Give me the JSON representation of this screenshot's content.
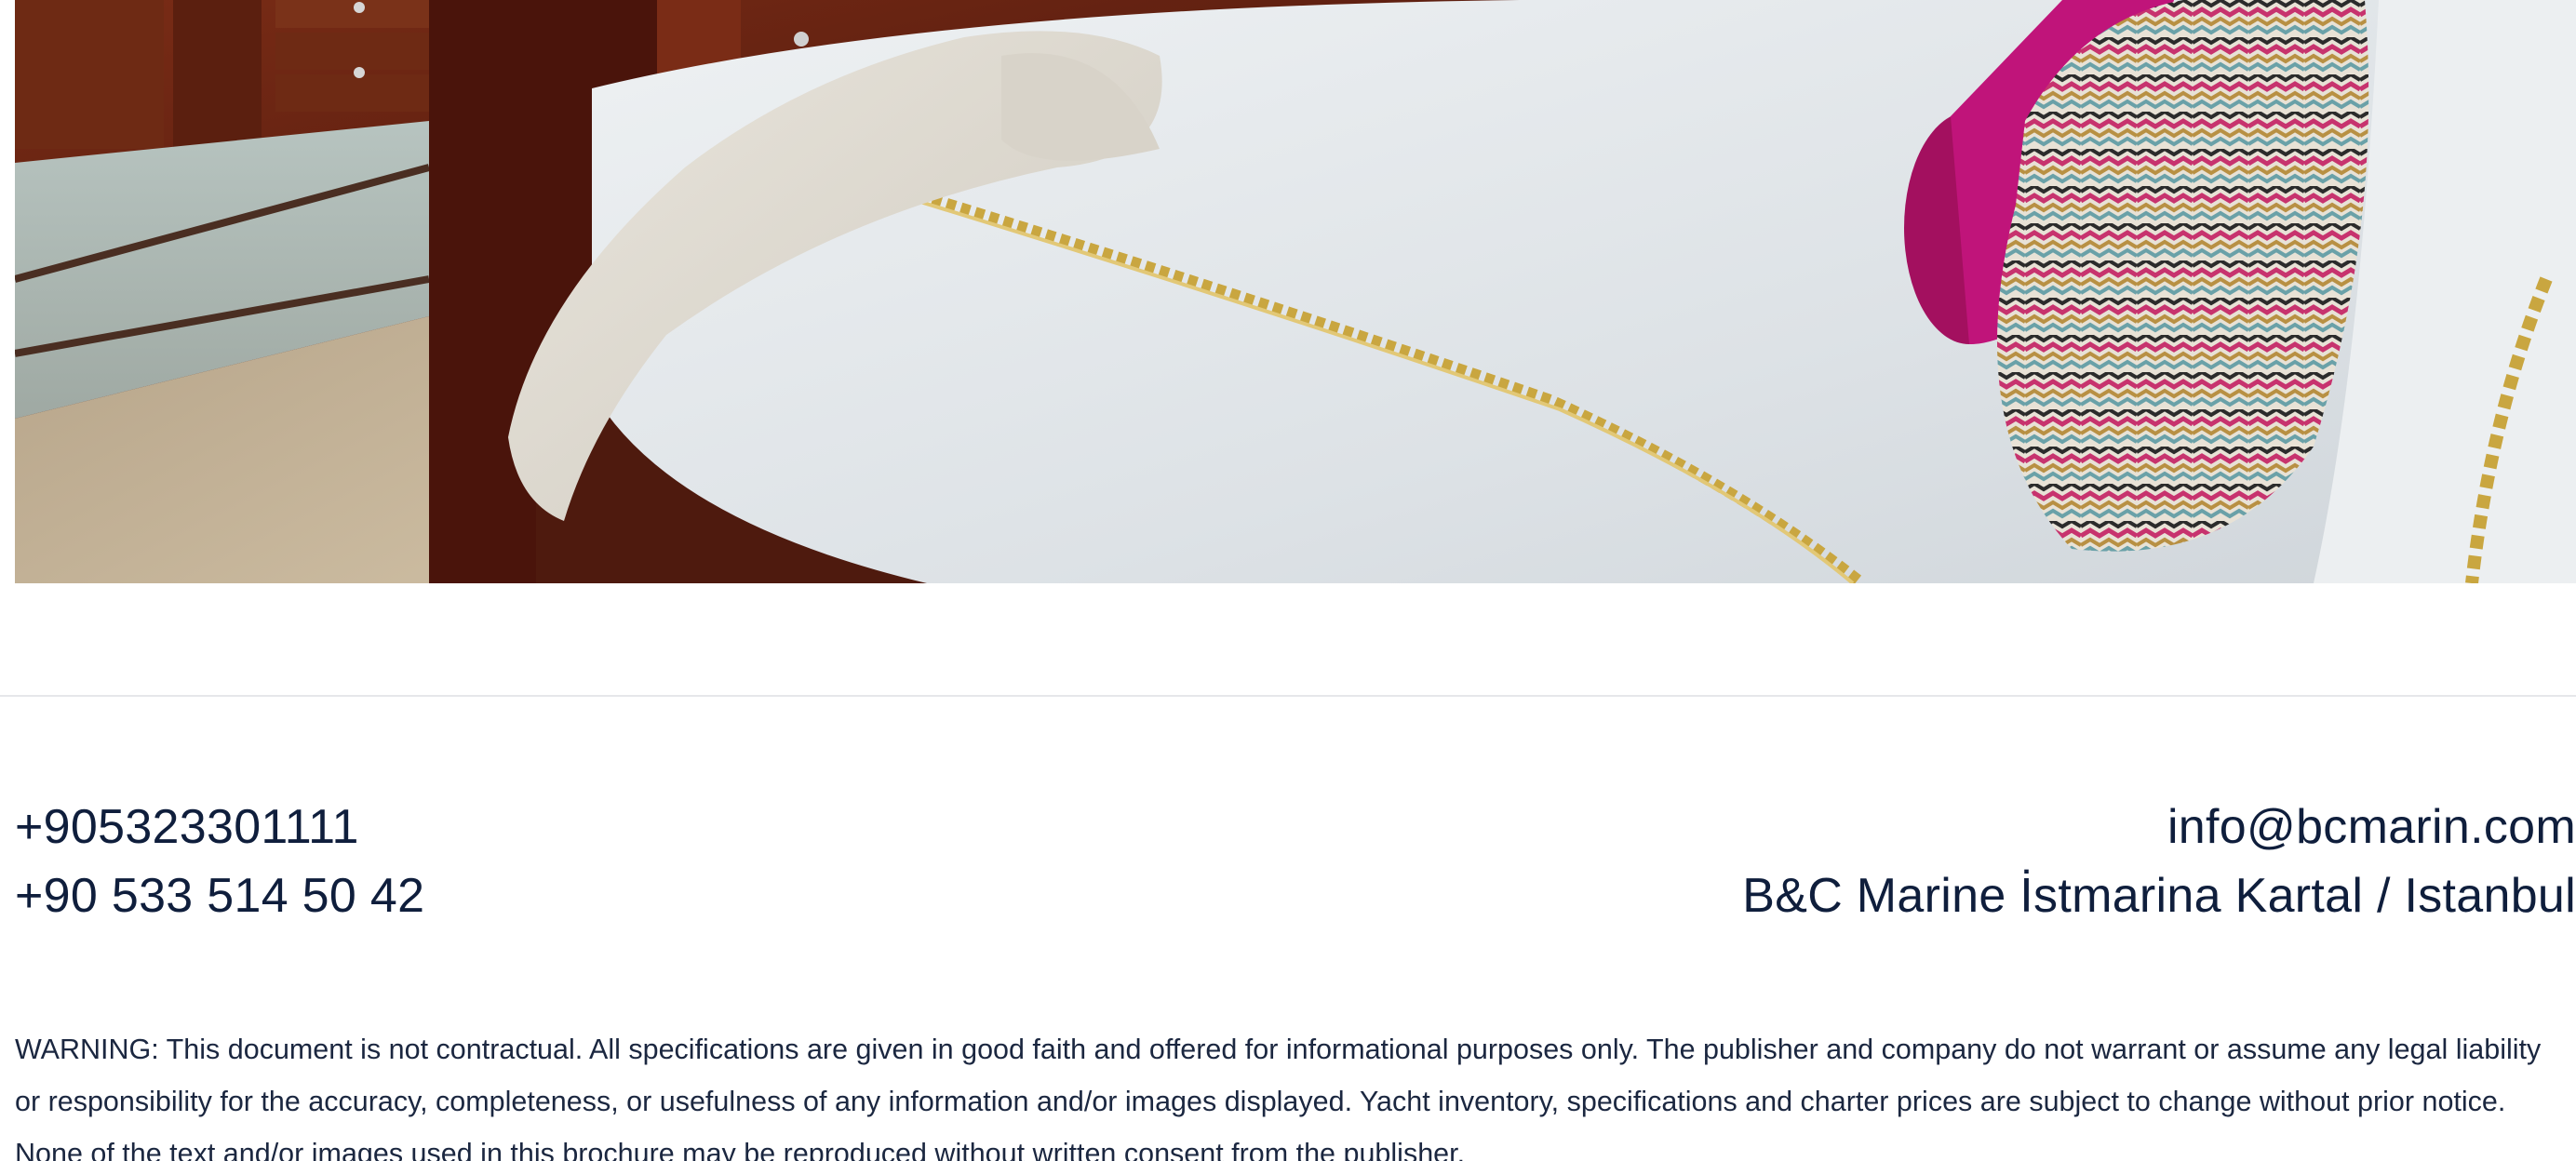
{
  "photo": {
    "alt": "Yacht cabin bedroom with white bedding, gold embroidered trim, magenta bolster cushion and patterned knit pillow"
  },
  "contact": {
    "phone_1": "+905323301111",
    "phone_2": "+90 533 514 50 42",
    "email": "info@bcmarin.com",
    "address": "B&C Marine İstmarina Kartal / Istanbul"
  },
  "footer": {
    "warning": "WARNING: This document is not contractual. All specifications are given in good faith and offered for informational purposes only. The publisher and company do not warrant or assume any legal liability or responsibility for the accuracy, completeness, or usefulness of any information and/or images displayed. Yacht inventory, specifications and charter prices are subject to change without prior notice. None of the text and/or images used in this brochure may be reproduced without written consent from the publisher."
  },
  "colors": {
    "text": "#0f1e3c",
    "divider": "#e6e7ea",
    "wood": "#5a1e12",
    "bedding": "#e3e7ea",
    "cushion_magenta": "#c0147a",
    "trim_gold": "#c9a640"
  }
}
